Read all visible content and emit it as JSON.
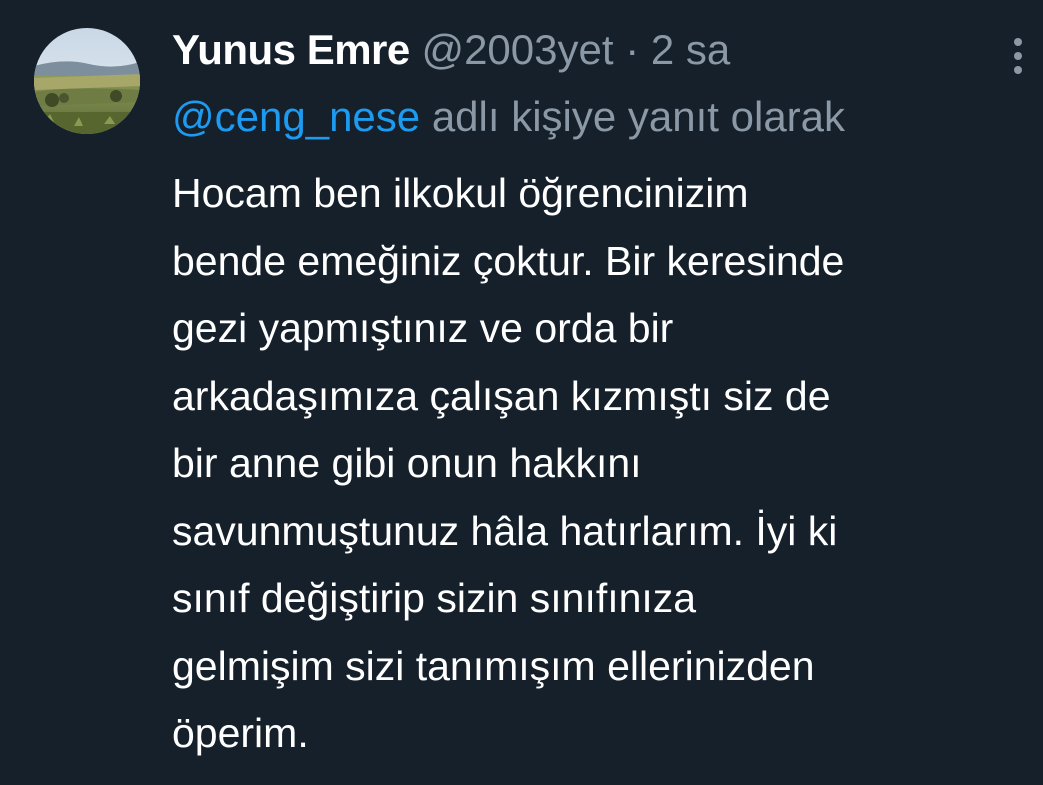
{
  "author": {
    "display_name": "Yunus Emre",
    "handle": "@2003yet",
    "separator": "·",
    "time_ago": "2 sa"
  },
  "reply": {
    "mention": "@ceng_nese",
    "text": "adlı kişiye yanıt olarak"
  },
  "menu": {
    "icon": "more-vertical-icon"
  },
  "tweet": {
    "lines": [
      "Hocam ben ilkokul öğrencinizim",
      "bende emeğiniz çoktur. Bir keresinde",
      "gezi yapmıştınız ve orda bir",
      "arkadaşımıza çalışan kızmıştı siz de",
      "bir anne gibi onun hakkını",
      "savunmuştunuz hâla hatırlarım. İyi ki",
      "sınıf değiştirip sizin sınıfınıza",
      "gelmişim sizi tanımışım ellerinizden",
      "öperim."
    ]
  },
  "colors": {
    "background": "#15202b",
    "text_primary": "#ffffff",
    "text_secondary": "#8b98a5",
    "link": "#1d9bf0"
  }
}
